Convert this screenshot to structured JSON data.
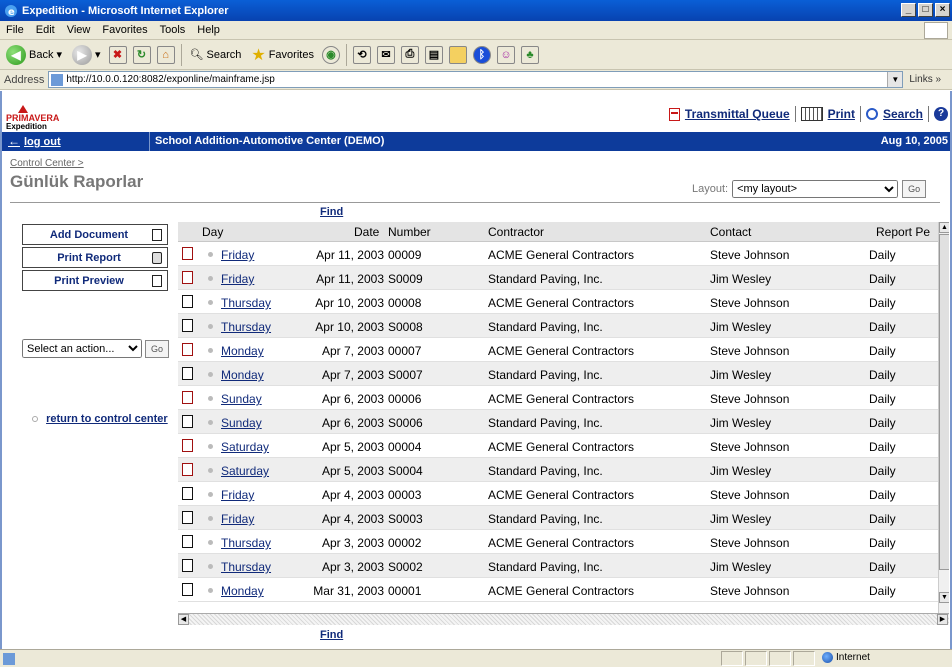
{
  "window": {
    "title": "Expedition - Microsoft Internet Explorer",
    "controls": [
      "_",
      "□",
      "×"
    ]
  },
  "menu": [
    "File",
    "Edit",
    "View",
    "Favorites",
    "Tools",
    "Help"
  ],
  "toolbar": {
    "back": "Back",
    "search": "Search",
    "favorites": "Favorites"
  },
  "address": {
    "label": "Address",
    "url": "http://10.0.0.120:8082/exponline/mainframe.jsp",
    "links": "Links"
  },
  "logo": {
    "name": "PRIMAVERA",
    "product": "Expedition"
  },
  "top_links": {
    "transmittal": "Transmittal Queue",
    "print": "Print",
    "search": "Search"
  },
  "bar": {
    "logout": "log out",
    "project": "School Addition-Automotive Center (DEMO)",
    "date": "Aug 10, 2005"
  },
  "breadcrumb": "Control Center >",
  "page_title": "Günlük Raporlar",
  "layout": {
    "label": "Layout:",
    "selected": "<my layout>",
    "go": "Go"
  },
  "find_label": "Find",
  "sidebar": {
    "add_document": "Add Document",
    "print_report": "Print Report",
    "print_preview": "Print Preview",
    "action_placeholder": "Select an action...",
    "action_go": "Go",
    "return_link": "return to control center"
  },
  "grid": {
    "columns": {
      "day": "Day",
      "date": "Date",
      "number": "Number",
      "contractor": "Contractor",
      "contact": "Contact",
      "report_period": "Report Pe"
    },
    "rows": [
      {
        "icon": "report-red-icon",
        "day": "Friday",
        "date": "Apr 11, 2003",
        "number": "00009",
        "contractor": "ACME General Contractors",
        "contact": "Steve Johnson",
        "period": "Daily"
      },
      {
        "icon": "report-red-icon",
        "day": "Friday",
        "date": "Apr 11, 2003",
        "number": "S0009",
        "contractor": "Standard Paving, Inc.",
        "contact": "Jim Wesley",
        "period": "Daily"
      },
      {
        "icon": "report-edit-icon",
        "day": "Thursday",
        "date": "Apr 10, 2003",
        "number": "00008",
        "contractor": "ACME General Contractors",
        "contact": "Steve Johnson",
        "period": "Daily"
      },
      {
        "icon": "report-edit-icon",
        "day": "Thursday",
        "date": "Apr 10, 2003",
        "number": "S0008",
        "contractor": "Standard Paving, Inc.",
        "contact": "Jim Wesley",
        "period": "Daily"
      },
      {
        "icon": "report-red-icon",
        "day": "Monday",
        "date": "Apr 7, 2003",
        "number": "00007",
        "contractor": "ACME General Contractors",
        "contact": "Steve Johnson",
        "period": "Daily"
      },
      {
        "icon": "report-edit-icon",
        "day": "Monday",
        "date": "Apr 7, 2003",
        "number": "S0007",
        "contractor": "Standard Paving, Inc.",
        "contact": "Jim Wesley",
        "period": "Daily"
      },
      {
        "icon": "report-red-icon",
        "day": "Sunday",
        "date": "Apr 6, 2003",
        "number": "00006",
        "contractor": "ACME General Contractors",
        "contact": "Steve Johnson",
        "period": "Daily"
      },
      {
        "icon": "report-edit-icon",
        "day": "Sunday",
        "date": "Apr 6, 2003",
        "number": "S0006",
        "contractor": "Standard Paving, Inc.",
        "contact": "Jim Wesley",
        "period": "Daily"
      },
      {
        "icon": "report-red-icon",
        "day": "Saturday",
        "date": "Apr 5, 2003",
        "number": "00004",
        "contractor": "ACME General Contractors",
        "contact": "Steve Johnson",
        "period": "Daily"
      },
      {
        "icon": "report-red-icon",
        "day": "Saturday",
        "date": "Apr 5, 2003",
        "number": "S0004",
        "contractor": "Standard Paving, Inc.",
        "contact": "Jim Wesley",
        "period": "Daily"
      },
      {
        "icon": "report-edit-icon",
        "day": "Friday",
        "date": "Apr 4, 2003",
        "number": "00003",
        "contractor": "ACME General Contractors",
        "contact": "Steve Johnson",
        "period": "Daily"
      },
      {
        "icon": "report-edit-icon",
        "day": "Friday",
        "date": "Apr 4, 2003",
        "number": "S0003",
        "contractor": "Standard Paving, Inc.",
        "contact": "Jim Wesley",
        "period": "Daily"
      },
      {
        "icon": "report-edit-icon",
        "day": "Thursday",
        "date": "Apr 3, 2003",
        "number": "00002",
        "contractor": "ACME General Contractors",
        "contact": "Steve Johnson",
        "period": "Daily"
      },
      {
        "icon": "report-edit-icon",
        "day": "Thursday",
        "date": "Apr 3, 2003",
        "number": "S0002",
        "contractor": "Standard Paving, Inc.",
        "contact": "Jim Wesley",
        "period": "Daily"
      },
      {
        "icon": "report-edit-icon",
        "day": "Monday",
        "date": "Mar 31, 2003",
        "number": "00001",
        "contractor": "ACME General Contractors",
        "contact": "Steve Johnson",
        "period": "Daily"
      }
    ]
  },
  "status": {
    "zone": "Internet"
  },
  "colors": {
    "brand_bar": "#0d3b9b",
    "link": "#102a7a",
    "logo_red": "#c81818"
  }
}
